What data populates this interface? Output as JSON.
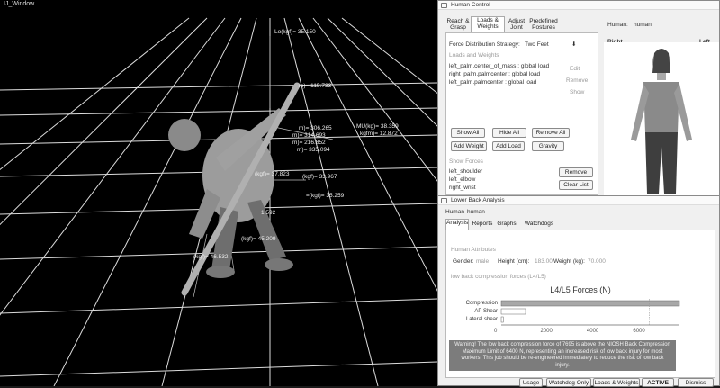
{
  "viewport": {
    "title": "IJ_Window",
    "measurements": [
      "Lo(kgf)= 35.150",
      "m)= 115.733",
      "m)= 306.265",
      "m)= 314.693",
      "m)= 216.852",
      "m)= 335.094",
      "MU(kg)= 38.359",
      "kgfm)= 12.872",
      "(kgf)= 37.823",
      "(kgf)= 33.967",
      "=(kgf)= 35.259",
      "(kgf)= 45.209",
      "(kgf)= 46.532",
      "1.592"
    ]
  },
  "human_control": {
    "title": "Human Control",
    "tabs": [
      "Reach & Grasp",
      "Loads & Weights",
      "Adjust Joint",
      "Predefined Postures"
    ],
    "active_tab": "Loads & Weights",
    "human_label": "Human:",
    "human_value": "human",
    "right_label": "Right",
    "left_label": "Left",
    "strategy_label": "Force Distribution Strategy:",
    "strategy_value": "Two Feet",
    "loads_header": "Loads and Weights",
    "loads": [
      "left_palm.center_of_mass : global load",
      "right_palm.palmcenter : global load",
      "left_palm.palmcenter : global load"
    ],
    "side_buttons": [
      "Edit",
      "Remove",
      "Show"
    ],
    "buttons": {
      "show_all": "Show All",
      "hide_all": "Hide All",
      "remove_all": "Remove All",
      "add_weight": "Add Weight",
      "add_load": "Add Load",
      "gravity": "Gravity"
    },
    "show_forces_header": "Show Forces",
    "forces": [
      "left_shoulder",
      "left_elbow",
      "right_wrist"
    ],
    "remove": "Remove",
    "clear_list": "Clear List"
  },
  "lba": {
    "title": "Lower Back Analysis",
    "human_label": "Human",
    "human_value": "human",
    "tabs": [
      "Analysis",
      "Reports",
      "Graphs",
      "Watchdogs"
    ],
    "active_tab": "Analysis",
    "attributes_header": "Human Attributes",
    "gender_label": "Gender:",
    "gender_value": "male",
    "height_label": "Height (cm):",
    "height_value": "183.00",
    "weight_label": "Weight (kg):",
    "weight_value": "70.000",
    "forces_header": "low back compression forces (L4/L5)",
    "warning": "Warning! The low back compression force of 7695 is above the NIOSH Back Compression Maximum Limit of 6400 N, representing an increased risk of low back injury for most workers. This job should be re-engineered immediately to reduce the risk of low back injury.",
    "bottom_tabs": [
      "Usage",
      "Watchdog Only",
      "Loads & Weights",
      "ACTIVE",
      "Dismiss"
    ]
  },
  "chart_data": {
    "type": "bar",
    "orientation": "horizontal",
    "title": "L4/L5 Forces (N)",
    "categories": [
      "Compression",
      "AP Shear",
      "Lateral shear"
    ],
    "values": [
      7695,
      1050,
      90
    ],
    "xlim": [
      0,
      7695
    ],
    "xticks": [
      "0",
      "2000",
      "4000",
      "6000"
    ],
    "limit_line": 6400,
    "colors": {
      "compression": "#a8a8a8",
      "other": "#ffffff"
    }
  }
}
